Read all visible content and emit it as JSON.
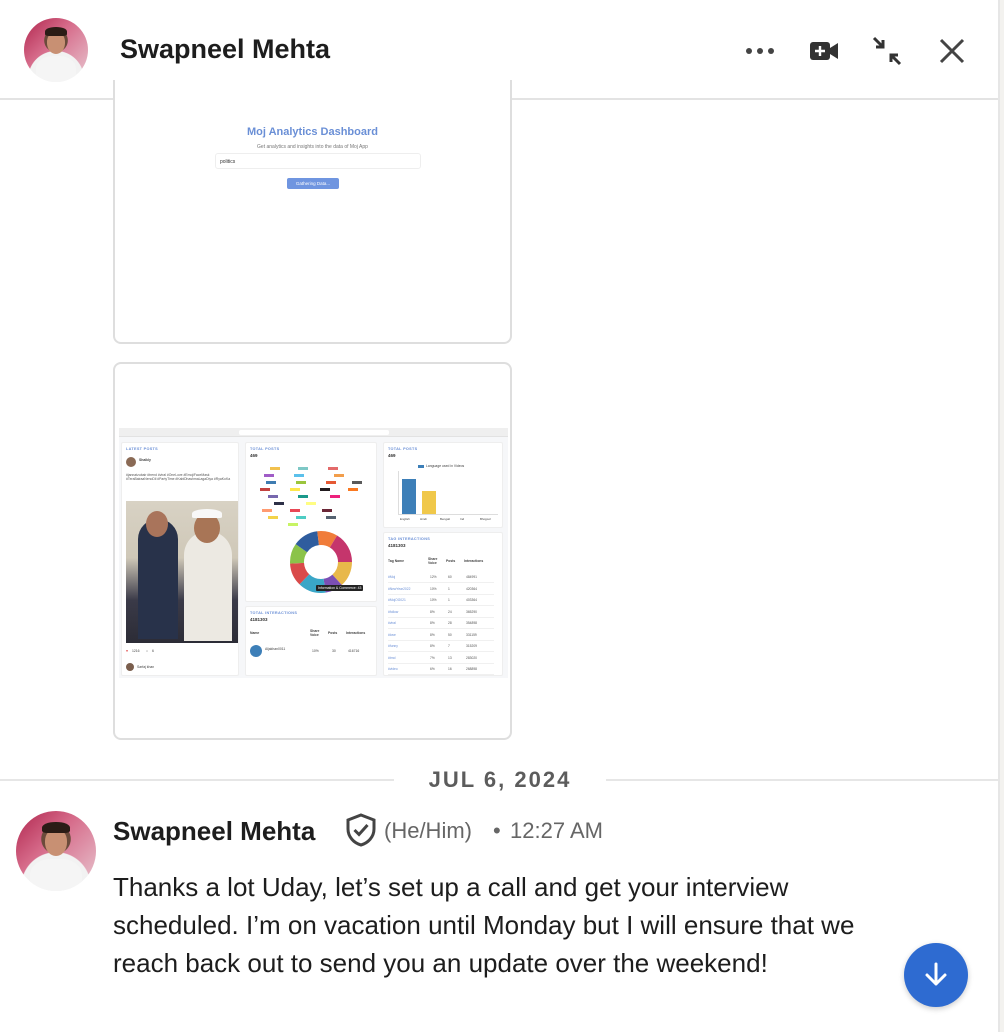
{
  "header": {
    "name": "Swapneel Mehta"
  },
  "attachment1": {
    "title": "Moj Analytics Dashboard",
    "subtitle": "Get analytics and insights into the data of Moj App",
    "query": "politics",
    "button": "Gathering Data..."
  },
  "attachment2": {
    "latest_posts_label": "LATEST POSTS",
    "total_posts_label": "TOTAL POSTS",
    "total_posts_value": "469",
    "total_posts_label2": "TOTAL POSTS",
    "total_posts_value2": "469",
    "tag_interactions_label": "TAG INTERACTIONS",
    "tag_interactions_value": "4181303",
    "total_interactions_label": "TOTAL INTERACTIONS",
    "total_interactions_value": "4181303",
    "chart_legend": "Language used in Videos",
    "languages": [
      "English",
      "Hindi",
      "Bengali",
      "Ind",
      "Bhojpuri"
    ],
    "tag_table_headers": [
      "Tag Name",
      "Share Voice",
      "Posts",
      "Interactions"
    ],
    "tag_rows": [
      [
        "#Moj",
        "12%",
        "60",
        "484991"
      ],
      [
        "#NewYear2022",
        "10%",
        "1",
        "420364"
      ],
      [
        "#MojOG021",
        "10%",
        "1",
        "403364"
      ],
      [
        "#follow",
        "8%",
        "24",
        "365290"
      ],
      [
        "#viral",
        "8%",
        "28",
        "354898"
      ],
      [
        "#love",
        "8%",
        "50",
        "331159"
      ],
      [
        "#funny",
        "8%",
        "7",
        "315209"
      ],
      [
        "#trnd",
        "7%",
        "13",
        "283020"
      ],
      [
        "#video",
        "6%",
        "16",
        "268898"
      ]
    ],
    "interactions_headers": [
      "Name",
      "Share Voice",
      "Posts",
      "Interactions"
    ],
    "interactions_row": [
      "Aljakhan0011",
      "10%",
      "30",
      "416716"
    ],
    "user_name": "Shaikly",
    "user2_name": "Sarfaj khan",
    "likes": "1216",
    "comments": "6",
    "donut_tooltip": "Information & Commerce: 43"
  },
  "divider": {
    "date": "JUL 6, 2024"
  },
  "message": {
    "name": "Swapneel Mehta",
    "pronouns": "(He/Him)",
    "separator": "•",
    "time": "12:27 AM",
    "body": "Thanks a lot Uday, let’s set up a call and get your interview scheduled. I’m on vacation until Monday but I will ensure that we reach back out to send you an update over the weekend!"
  },
  "colors": {
    "accent": "#2e6bd1",
    "chart_blue": "#3d7fb8",
    "chart_yellow": "#f0c84a"
  },
  "chart_data": {
    "type": "bar",
    "title": "Language used in Videos",
    "categories": [
      "English",
      "Hindi",
      "Bengali",
      "Ind",
      "Bhojpuri"
    ],
    "values": [
      320,
      210,
      0,
      0,
      0
    ],
    "ylim": [
      0,
      400
    ]
  }
}
